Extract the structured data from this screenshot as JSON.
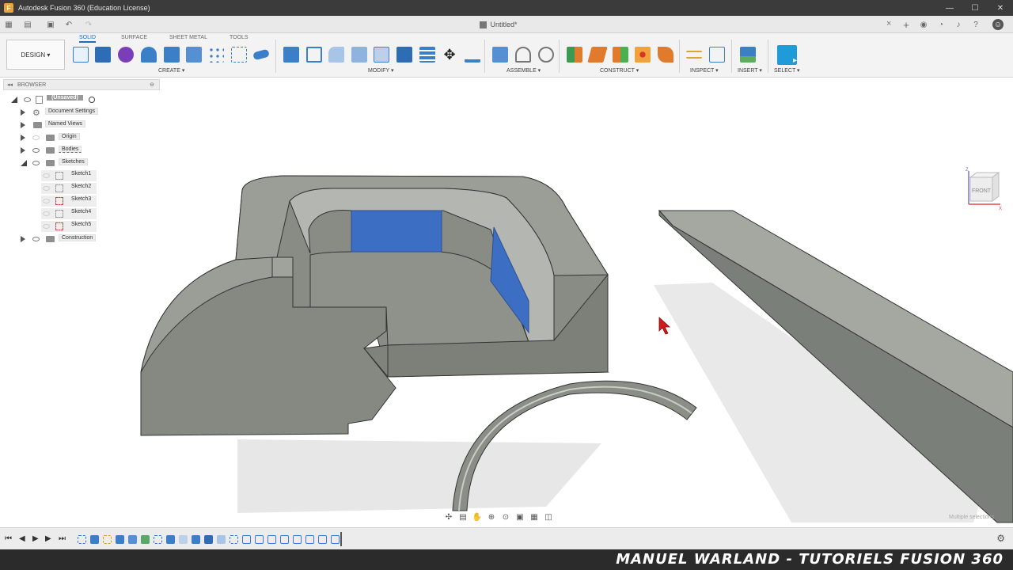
{
  "window": {
    "title": "Autodesk Fusion 360 (Education License)",
    "minimize": "—",
    "maximize": "☐",
    "close": "✕"
  },
  "tabbar": {
    "document_title": "Untitled*",
    "close_tab": "×"
  },
  "toolbar": {
    "workspace_button": "DESIGN ▾",
    "tabs": [
      "SOLID",
      "SURFACE",
      "SHEET METAL",
      "TOOLS"
    ],
    "active_tab": "SOLID",
    "groups": [
      "CREATE ▾",
      "MODIFY ▾",
      "ASSEMBLE ▾",
      "CONSTRUCT ▾",
      "INSPECT ▾",
      "INSERT ▾",
      "SELECT ▾"
    ]
  },
  "browser": {
    "title": "BROWSER",
    "root": "(Unsaved)",
    "items": [
      "Document Settings",
      "Named Views",
      "Origin",
      "Bodies",
      "Sketches",
      "Construction"
    ],
    "sketches": [
      "Sketch1",
      "Sketch2",
      "Sketch3",
      "Sketch4",
      "Sketch5"
    ]
  },
  "viewport": {
    "viewcube_label": "FRONT",
    "axis_z": "Z",
    "axis_x": "X",
    "status_hint": "Multiple selections"
  },
  "banner": {
    "text": "MANUEL WARLAND - TUTORIELS FUSION 360"
  },
  "colors": {
    "body": "#8d918a",
    "selected_face": "#3c6fc4",
    "accent": "#1a6fb8",
    "cursor": "#d11a1a"
  },
  "icons": [
    "grid-icon",
    "file-icon",
    "save-icon",
    "undo-icon",
    "redo-icon",
    "sketch-icon",
    "extrude-icon",
    "form-icon",
    "move-icon",
    "viewcube-icon",
    "orbit-icon",
    "pan-icon",
    "zoom-icon",
    "settings-gear-icon"
  ]
}
